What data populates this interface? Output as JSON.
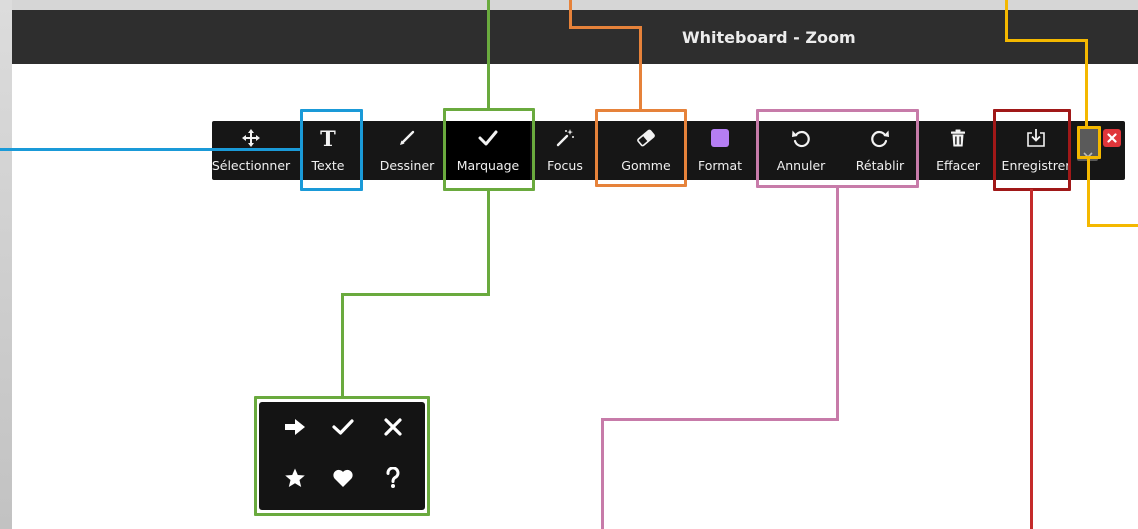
{
  "window": {
    "title": "Whiteboard - Zoom"
  },
  "toolbar": {
    "tools": [
      {
        "label": "Sélectionner",
        "icon": "move-arrows-icon"
      },
      {
        "label": "Texte",
        "icon": "text-t-icon"
      },
      {
        "label": "Dessiner",
        "icon": "pencil-icon"
      },
      {
        "label": "Marquage",
        "icon": "checkmark-icon"
      },
      {
        "label": "Focus",
        "icon": "magic-wand-icon"
      },
      {
        "label": "Gomme",
        "icon": "eraser-icon"
      },
      {
        "label": "Format",
        "icon": "color-swatch-icon"
      },
      {
        "label": "Annuler",
        "icon": "undo-icon"
      },
      {
        "label": "Rétablir",
        "icon": "redo-icon"
      },
      {
        "label": "Effacer",
        "icon": "trash-icon"
      },
      {
        "label": "Enregistrer",
        "icon": "save-download-icon"
      }
    ],
    "collapse_icon": "chevron-down-icon",
    "close_icon": "close-icon",
    "format_color": "#b57ef3"
  },
  "stamp_panel": {
    "stamps": [
      "arrow-right-icon",
      "checkmark-icon",
      "cross-icon",
      "star-icon",
      "heart-icon",
      "question-icon"
    ]
  },
  "annotation_colors": {
    "blue": "#1a9ad8",
    "green": "#6aaa3e",
    "orange": "#e6823a",
    "pink": "#c77ba9",
    "dark_red": "#a01818",
    "red": "#c42a2a",
    "yellow": "#f4b800"
  }
}
